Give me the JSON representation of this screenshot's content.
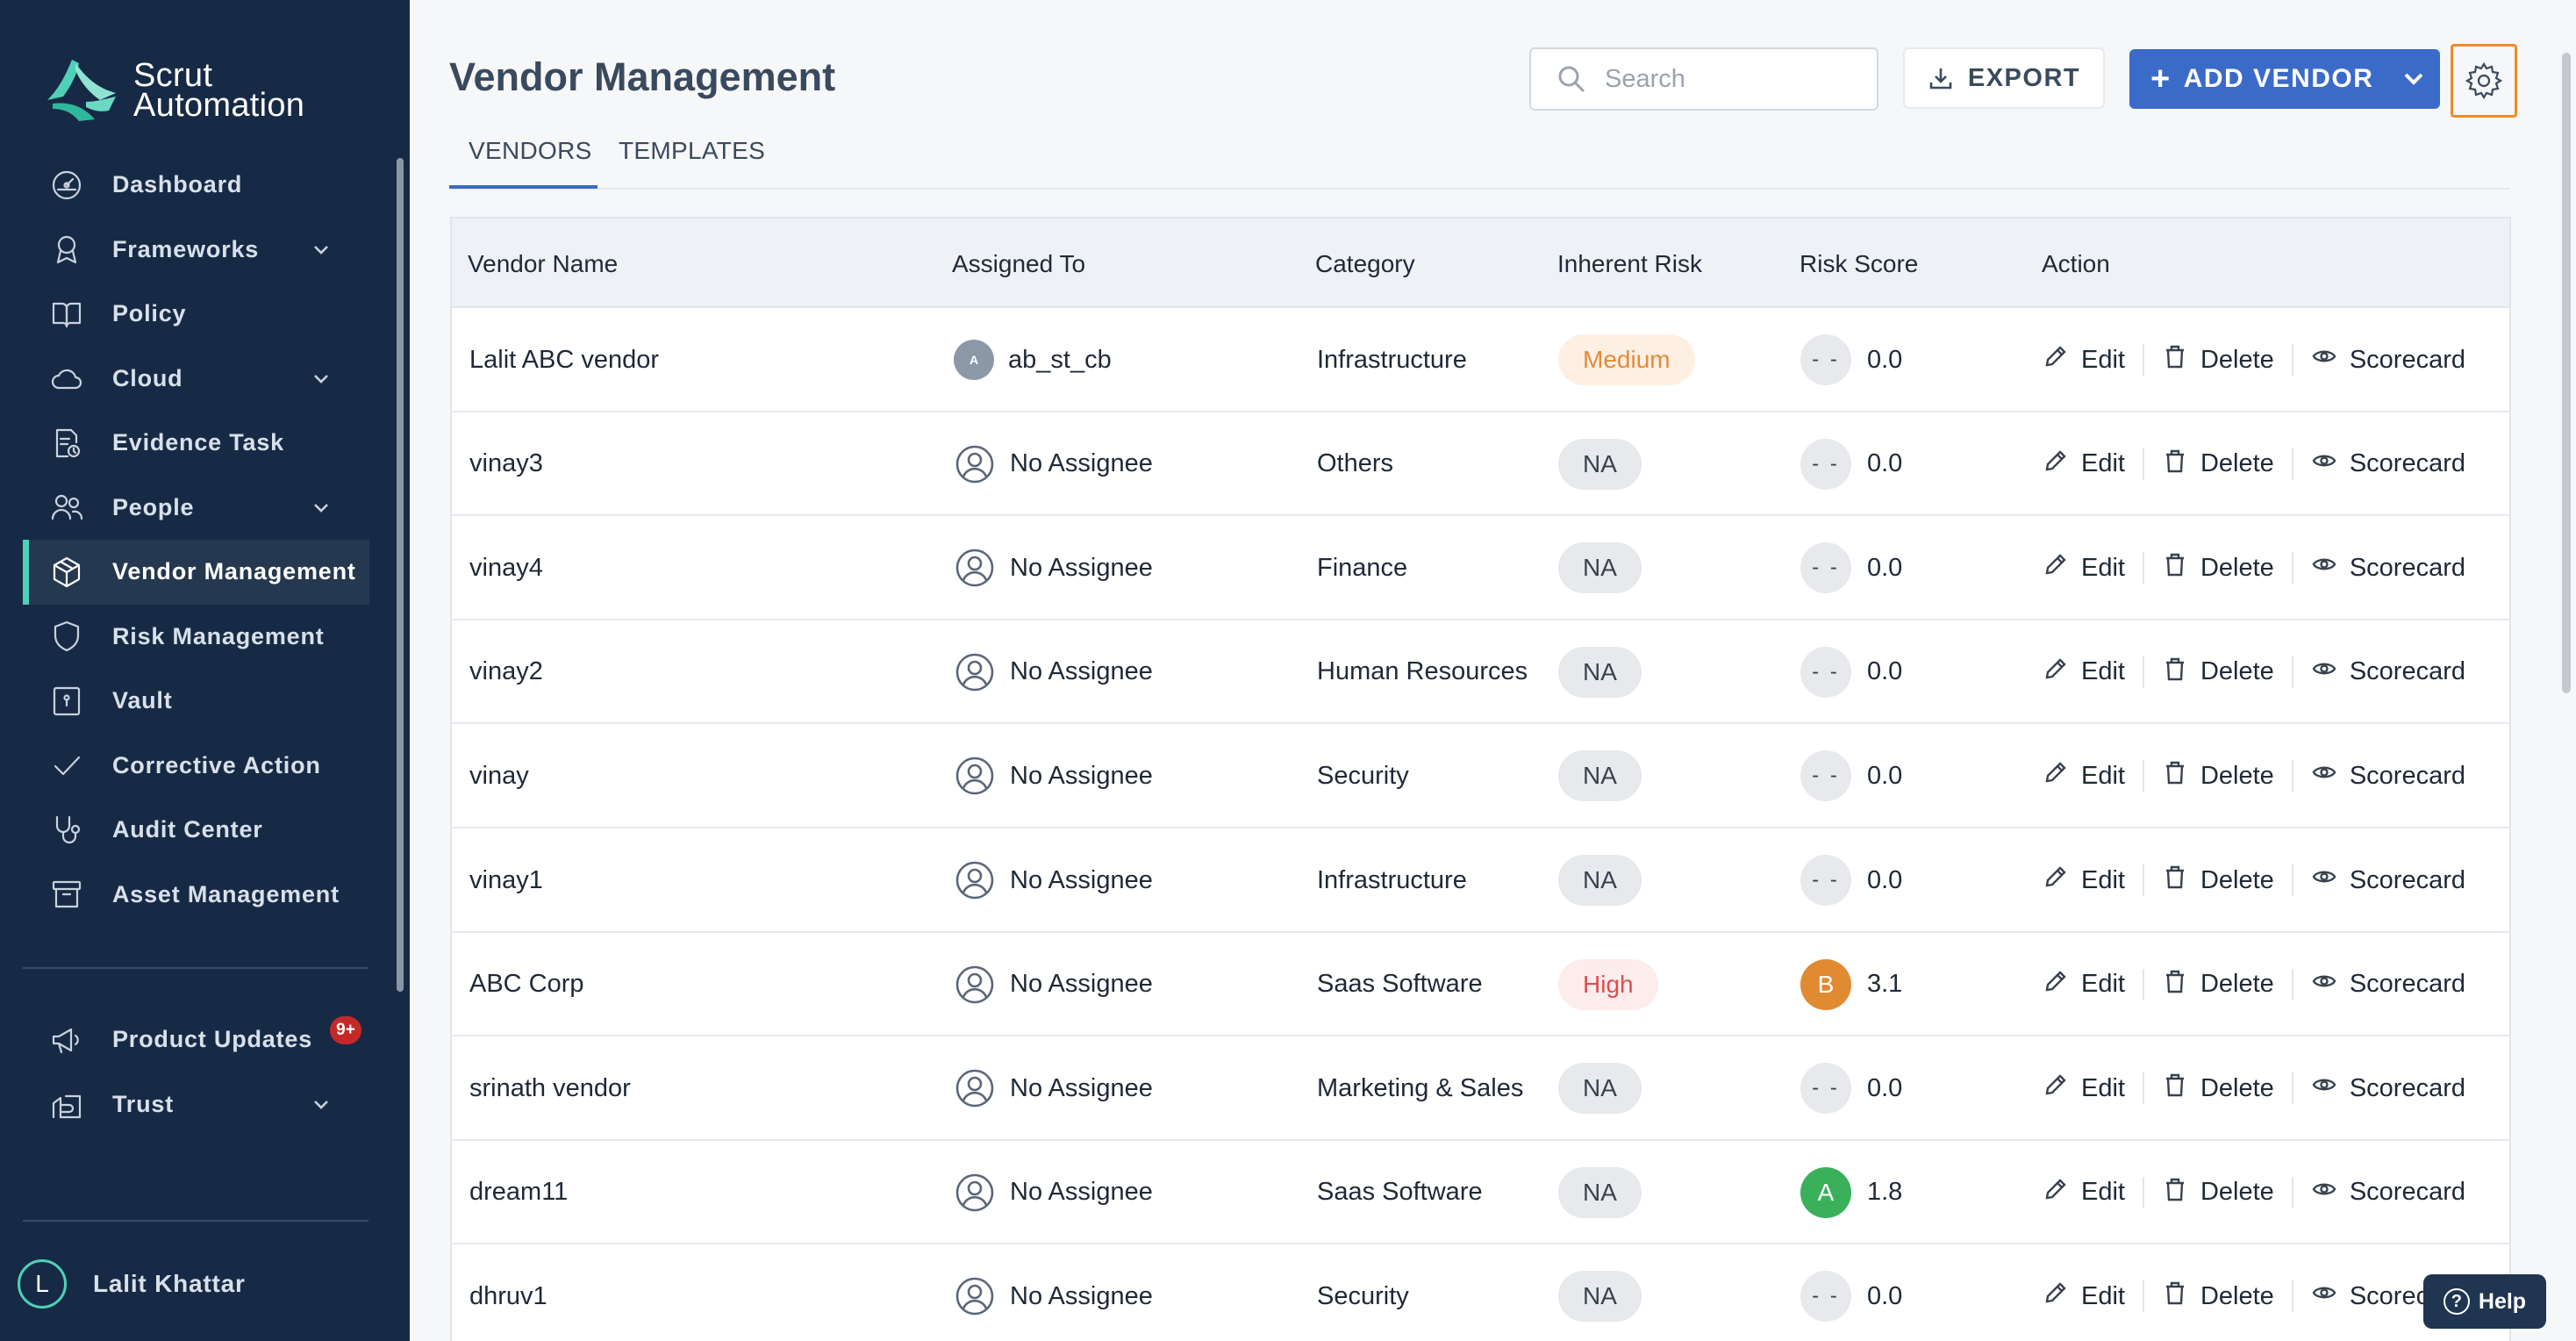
{
  "brand": {
    "name_line1": "Scrut",
    "name_line2": "Automation"
  },
  "sidebar": {
    "items": [
      {
        "label": "Dashboard",
        "icon": "dashboard-icon",
        "expandable": false
      },
      {
        "label": "Frameworks",
        "icon": "award-icon",
        "expandable": true
      },
      {
        "label": "Policy",
        "icon": "book-icon",
        "expandable": false
      },
      {
        "label": "Cloud",
        "icon": "cloud-icon",
        "expandable": true
      },
      {
        "label": "Evidence Task",
        "icon": "document-icon",
        "expandable": false
      },
      {
        "label": "People",
        "icon": "people-icon",
        "expandable": true
      },
      {
        "label": "Vendor Management",
        "icon": "cube-icon",
        "expandable": false,
        "active": true
      },
      {
        "label": "Risk Management",
        "icon": "shield-icon",
        "expandable": false
      },
      {
        "label": "Vault",
        "icon": "vault-icon",
        "expandable": false
      },
      {
        "label": "Corrective Action",
        "icon": "check-icon",
        "expandable": false
      },
      {
        "label": "Audit Center",
        "icon": "stethoscope-icon",
        "expandable": false
      },
      {
        "label": "Asset Management",
        "icon": "archive-icon",
        "expandable": false
      }
    ],
    "bottom_items": [
      {
        "label": "Product Updates",
        "icon": "megaphone-icon",
        "badge": "9+"
      },
      {
        "label": "Trust",
        "icon": "trust-icon",
        "expandable": true
      }
    ],
    "user": {
      "initial": "L",
      "name": "Lalit Khattar"
    }
  },
  "header": {
    "title": "Vendor Management",
    "search_placeholder": "Search",
    "export_label": "EXPORT",
    "add_vendor_label": "ADD VENDOR"
  },
  "tabs": [
    {
      "label": "VENDORS",
      "active": true
    },
    {
      "label": "TEMPLATES",
      "active": false
    }
  ],
  "table": {
    "columns": [
      "Vendor Name",
      "Assigned To",
      "Category",
      "Inherent Risk",
      "Risk Score",
      "Action"
    ],
    "actions": {
      "edit": "Edit",
      "delete": "Delete",
      "scorecard": "Scorecard"
    },
    "rows": [
      {
        "name": "Lalit ABC vendor",
        "assignee": "ab_st_cb",
        "assignee_initial": "A",
        "category": "Infrastructure",
        "risk": "Medium",
        "grade": "- -",
        "score": "0.0"
      },
      {
        "name": "vinay3",
        "assignee": "No Assignee",
        "category": "Others",
        "risk": "NA",
        "grade": "- -",
        "score": "0.0"
      },
      {
        "name": "vinay4",
        "assignee": "No Assignee",
        "category": "Finance",
        "risk": "NA",
        "grade": "- -",
        "score": "0.0"
      },
      {
        "name": "vinay2",
        "assignee": "No Assignee",
        "category": "Human Resources",
        "risk": "NA",
        "grade": "- -",
        "score": "0.0"
      },
      {
        "name": "vinay",
        "assignee": "No Assignee",
        "category": "Security",
        "risk": "NA",
        "grade": "- -",
        "score": "0.0"
      },
      {
        "name": "vinay1",
        "assignee": "No Assignee",
        "category": "Infrastructure",
        "risk": "NA",
        "grade": "- -",
        "score": "0.0"
      },
      {
        "name": "ABC Corp",
        "assignee": "No Assignee",
        "category": "Saas Software",
        "risk": "High",
        "grade": "B",
        "score": "3.1"
      },
      {
        "name": "srinath vendor",
        "assignee": "No Assignee",
        "category": "Marketing & Sales",
        "risk": "NA",
        "grade": "- -",
        "score": "0.0"
      },
      {
        "name": "dream11",
        "assignee": "No Assignee",
        "category": "Saas Software",
        "risk": "NA",
        "grade": "A",
        "score": "1.8"
      },
      {
        "name": "dhruv1",
        "assignee": "No Assignee",
        "category": "Security",
        "risk": "NA",
        "grade": "- -",
        "score": "0.0"
      }
    ]
  },
  "help_label": "Help",
  "colors": {
    "sidebar_bg": "#172a45",
    "accent": "#4fd1b7",
    "primary": "#3b6bc9",
    "settings_highlight": "#ef8b2c"
  }
}
